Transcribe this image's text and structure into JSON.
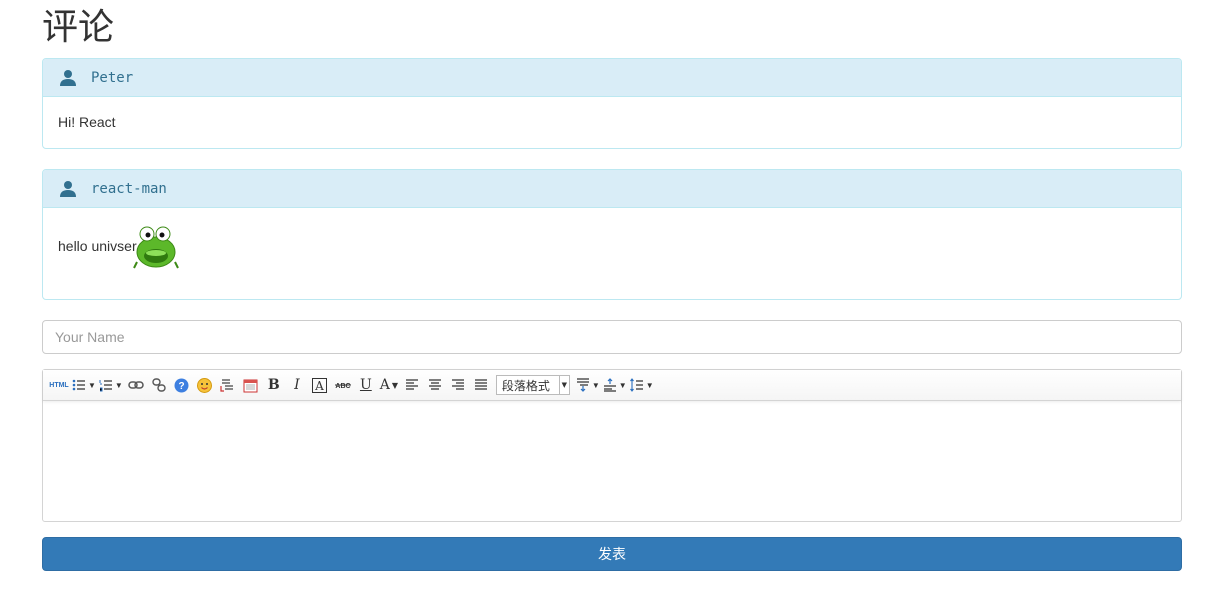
{
  "page": {
    "title": "评论"
  },
  "comments": [
    {
      "author": "Peter",
      "text": "Hi! React"
    },
    {
      "author": "react-man",
      "text": "hello univser",
      "emoticon": "frog-emoticon"
    }
  ],
  "form": {
    "name_placeholder": "Your Name",
    "submit_label": "发表",
    "submit_color": "#337ab7"
  },
  "editor": {
    "toolbar": {
      "html_label": "HTML",
      "paragraph_format": "段落格式",
      "icons": [
        "html-icon",
        "unordered-list-icon",
        "ordered-list-icon",
        "link-icon",
        "unlink-icon",
        "help-icon",
        "emoticon-icon",
        "image-icon",
        "calendar-icon",
        "bold-icon",
        "italic-icon",
        "font-icon",
        "strikethrough-icon",
        "underline-icon",
        "font-color-icon",
        "align-left-icon",
        "align-center-icon",
        "align-right-icon",
        "align-justify-icon",
        "paragraph-spacing-icon",
        "row-spacing-icon",
        "line-height-icon"
      ]
    }
  },
  "colors": {
    "panel_heading_bg": "#d9edf7",
    "panel_border": "#bce8f1",
    "panel_heading_text": "#31708f"
  }
}
